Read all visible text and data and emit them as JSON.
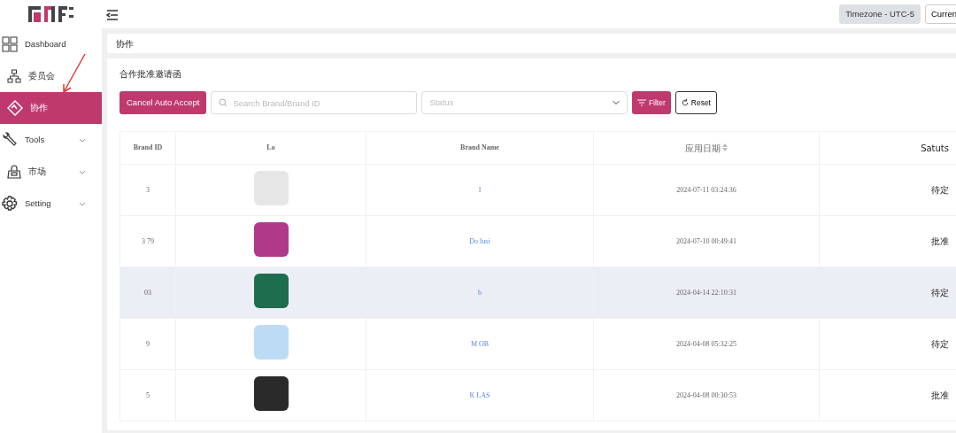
{
  "header": {
    "timezone": "Timezone - UTC-5",
    "currency_button": "Curren"
  },
  "sidebar": {
    "items": [
      {
        "label": "Dashboard",
        "selected": false,
        "has_submenu": false
      },
      {
        "label": "委员会",
        "selected": false,
        "has_submenu": false
      },
      {
        "label": "协作",
        "selected": true,
        "has_submenu": false
      },
      {
        "label": "Tools",
        "selected": false,
        "has_submenu": true
      },
      {
        "label": "市场",
        "selected": false,
        "has_submenu": true
      },
      {
        "label": "Setting",
        "selected": false,
        "has_submenu": true
      }
    ]
  },
  "breadcrumb": "协作",
  "card_title": "合作批准邀请函",
  "toolbar": {
    "cancel_button": "Cancel Auto Accept",
    "search": {
      "placeholder": "Search Brand/Brand ID"
    },
    "status": {
      "placeholder": "Status"
    },
    "filter_button": "Filter",
    "reset_button": "Reset"
  },
  "table": {
    "columns": [
      "Brand ID",
      "Lo",
      "Brand Name",
      "应用日期",
      "Satuts"
    ],
    "rows": [
      {
        "brand_id": "3",
        "color": "#e6e6e6",
        "brand_name": "I",
        "date": "2024-07-11 03:24:36",
        "status": "待定",
        "hovered": false
      },
      {
        "brand_id": "3 79",
        "color": "#b03a8a",
        "brand_name": "Do lusi",
        "date": "2024-07-10 00:49:41",
        "status": "批准",
        "hovered": false
      },
      {
        "brand_id": "03",
        "color": "#1d6e4e",
        "brand_name": "b",
        "date": "2024-04-14 22:10:31",
        "status": "待定",
        "hovered": true
      },
      {
        "brand_id": "9",
        "color": "#bcdcf5",
        "brand_name": "M OB",
        "date": "2024-04-08 05:32:25",
        "status": "待定",
        "hovered": false
      },
      {
        "brand_id": "5",
        "color": "#2a2a2a",
        "brand_name": "K LAS",
        "date": "2024-04-08 00:30:53",
        "status": "批准",
        "hovered": false
      }
    ]
  }
}
